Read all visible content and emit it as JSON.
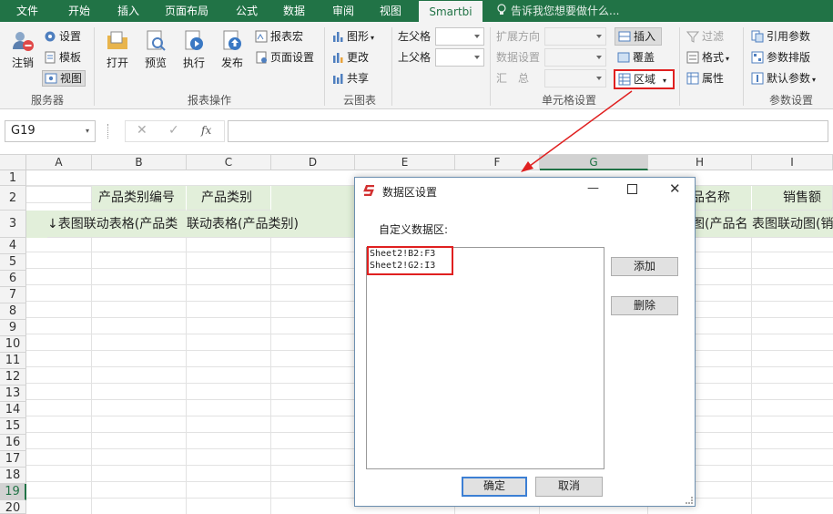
{
  "tabs": [
    "文件",
    "开始",
    "插入",
    "页面布局",
    "公式",
    "数据",
    "审阅",
    "视图",
    "Smartbi"
  ],
  "tell_me": "告诉我您想要做什么...",
  "ribbon": {
    "server": {
      "logout": "注销",
      "settings": "设置",
      "template": "模板",
      "view": "视图",
      "group": "服务器"
    },
    "report": {
      "open": "打开",
      "preview": "预览",
      "execute": "执行",
      "publish": "发布",
      "macro": "报表宏",
      "page_setup": "页面设置",
      "group": "报表操作"
    },
    "cloud": {
      "graph": "图形",
      "change": "更改",
      "share": "共享",
      "group": "云图表"
    },
    "parent": {
      "left": "左父格",
      "top": "上父格"
    },
    "cellset": {
      "expand": "扩展方向",
      "data_setting": "数据设置",
      "summary": "汇　总",
      "insert": "插入",
      "overwrite": "覆盖",
      "region": "区域",
      "group": "单元格设置"
    },
    "misc": {
      "filter": "过滤",
      "format": "格式",
      "attribute": "属性"
    },
    "param": {
      "ref": "引用参数",
      "arrange": "参数排版",
      "default": "默认参数",
      "group": "参数设置"
    }
  },
  "name_box": "G19",
  "columns": [
    "A",
    "B",
    "C",
    "D",
    "E",
    "F",
    "G",
    "H",
    "I"
  ],
  "rows": [
    "1",
    "2",
    "3",
    "4",
    "5",
    "6",
    "7",
    "8",
    "9",
    "10",
    "11",
    "12",
    "13",
    "14",
    "15",
    "16",
    "17",
    "18",
    "19",
    "20"
  ],
  "cells": {
    "b2": "产品类别编号",
    "c2": "产品类别",
    "h2": "品名称",
    "i2": "销售额",
    "a3": "↓表图联动表格(产品类",
    "c3": "联动表格(产品类别)",
    "h3": "图(产品名",
    "i3": "表图联动图(销"
  },
  "dialog": {
    "title": "数据区设置",
    "label": "自定义数据区:",
    "items": [
      "Sheet2!B2:F3",
      "Sheet2!G2:I3"
    ],
    "add": "添加",
    "delete": "删除",
    "ok": "确定",
    "cancel": "取消"
  },
  "colors": {
    "excel_green": "#217346",
    "highlight_red": "#e02020",
    "row_fill": "#e2efda"
  }
}
